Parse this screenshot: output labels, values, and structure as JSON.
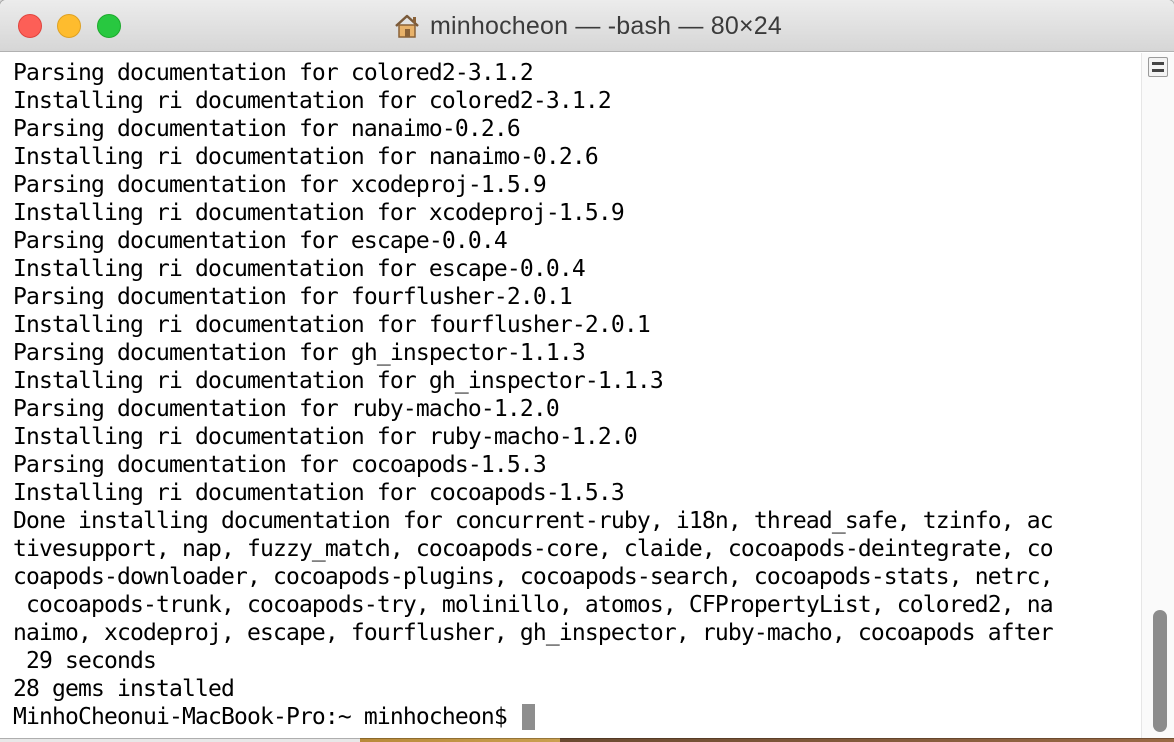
{
  "window": {
    "title": "minhocheon — -bash — 80×24",
    "title_icon": "home-folder-icon"
  },
  "terminal": {
    "lines": [
      "Parsing documentation for colored2-3.1.2",
      "Installing ri documentation for colored2-3.1.2",
      "Parsing documentation for nanaimo-0.2.6",
      "Installing ri documentation for nanaimo-0.2.6",
      "Parsing documentation for xcodeproj-1.5.9",
      "Installing ri documentation for xcodeproj-1.5.9",
      "Parsing documentation for escape-0.0.4",
      "Installing ri documentation for escape-0.0.4",
      "Parsing documentation for fourflusher-2.0.1",
      "Installing ri documentation for fourflusher-2.0.1",
      "Parsing documentation for gh_inspector-1.1.3",
      "Installing ri documentation for gh_inspector-1.1.3",
      "Parsing documentation for ruby-macho-1.2.0",
      "Installing ri documentation for ruby-macho-1.2.0",
      "Parsing documentation for cocoapods-1.5.3",
      "Installing ri documentation for cocoapods-1.5.3",
      "Done installing documentation for concurrent-ruby, i18n, thread_safe, tzinfo, ac",
      "tivesupport, nap, fuzzy_match, cocoapods-core, claide, cocoapods-deintegrate, co",
      "coapods-downloader, cocoapods-plugins, cocoapods-search, cocoapods-stats, netrc,",
      " cocoapods-trunk, cocoapods-try, molinillo, atomos, CFPropertyList, colored2, na",
      "naimo, xcodeproj, escape, fourflusher, gh_inspector, ruby-macho, cocoapods after",
      " 29 seconds",
      "28 gems installed"
    ],
    "prompt": "MinhoCheonui-MacBook-Pro:~ minhocheon$ "
  },
  "colors": {
    "close": "#fd5f57",
    "minimize": "#febc2e",
    "zoom": "#28c840",
    "cursor": "#8e8e8e"
  }
}
